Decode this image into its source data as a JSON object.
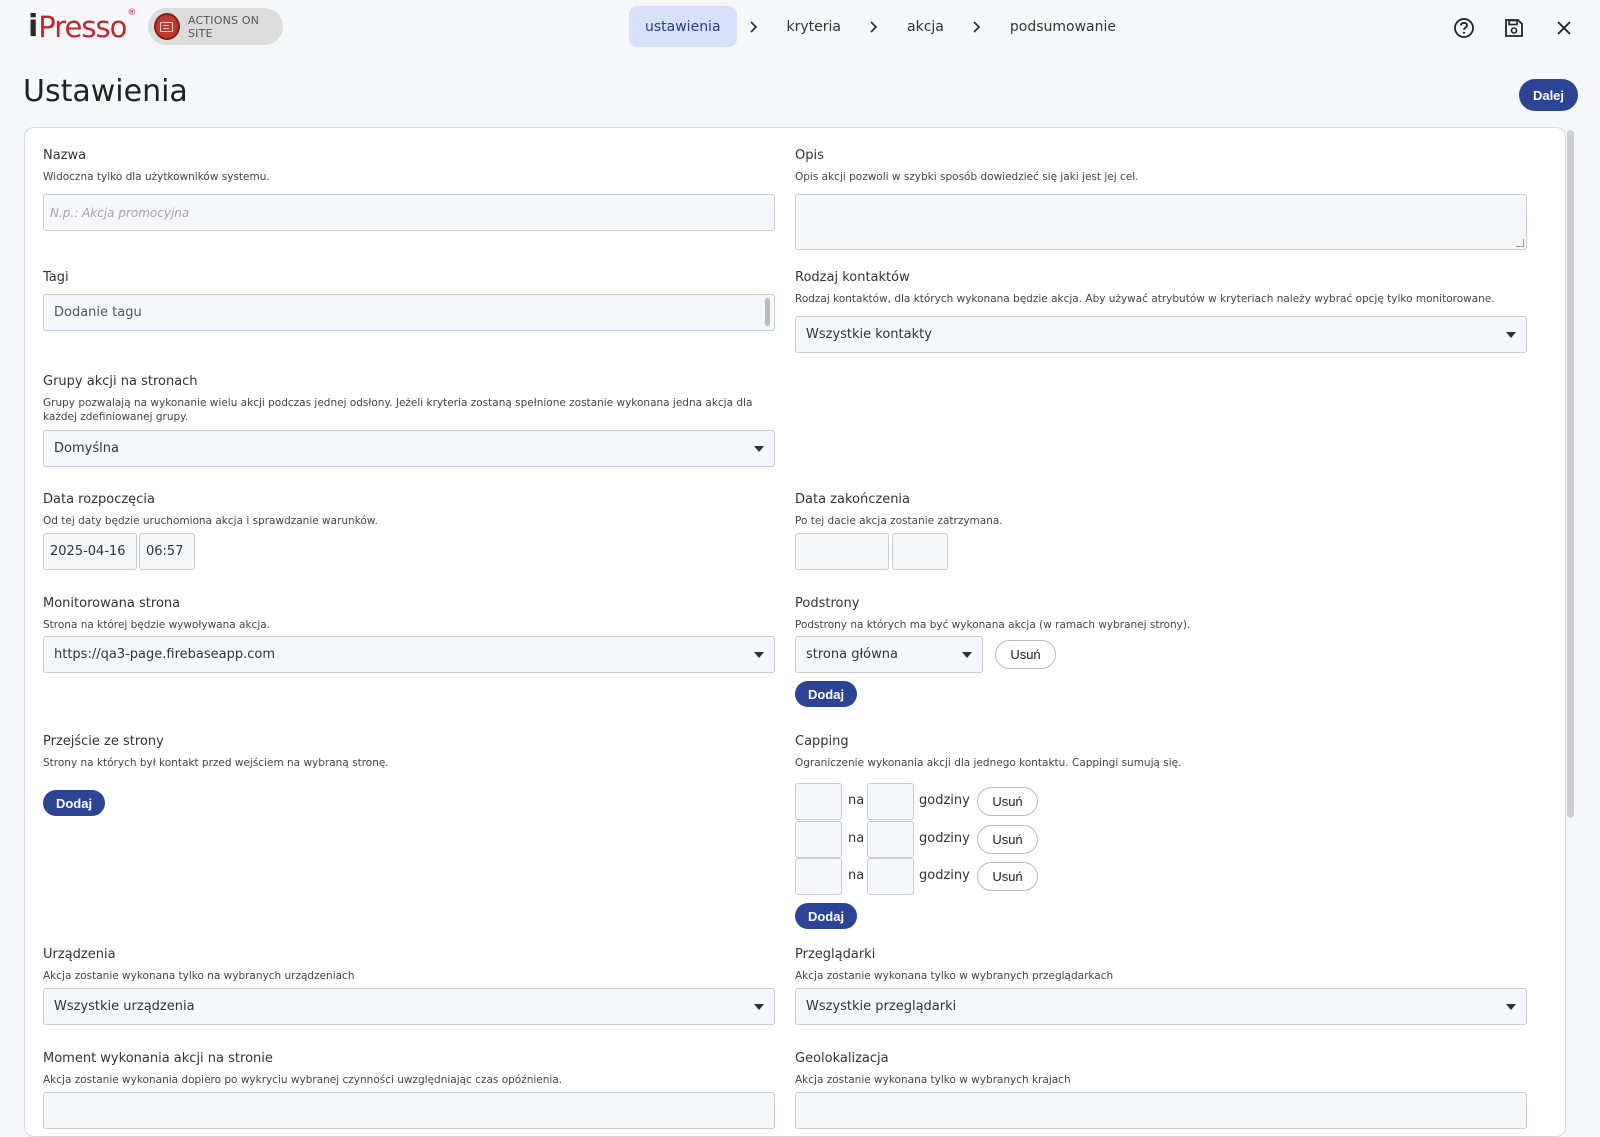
{
  "app": {
    "logo_i": "i",
    "logo_text": "Presso",
    "logo_reg": "®",
    "module_label": "ACTIONS ON SITE"
  },
  "steps": [
    {
      "label": "ustawienia",
      "active": true
    },
    {
      "label": "kryteria",
      "active": false
    },
    {
      "label": "akcja",
      "active": false
    },
    {
      "label": "podsumowanie",
      "active": false
    }
  ],
  "icons": {
    "step_separator": "chevron-right-icon",
    "help": "help-icon",
    "save": "save-icon",
    "close": "close-icon"
  },
  "header": {
    "title": "Ustawienia",
    "next_label": "Dalej"
  },
  "form": {
    "name": {
      "label": "Nazwa",
      "hint": "Widoczna tylko dla użytkowników systemu.",
      "placeholder": "N.p.: Akcja promocyjna",
      "value": ""
    },
    "description": {
      "label": "Opis",
      "hint": "Opis akcji pozwoli w szybki sposób dowiedzieć się jaki jest jej cel.",
      "value": ""
    },
    "tags": {
      "label": "Tagi",
      "value": "Dodanie tagu"
    },
    "contact_type": {
      "label": "Rodzaj kontaktów",
      "hint": "Rodzaj kontaktów, dla których wykonana będzie akcja. Aby używać atrybutów w kryteriach należy wybrać opcję tylko monitorowane.",
      "value": "Wszystkie kontakty"
    },
    "groups": {
      "label": "Grupy akcji na stronach",
      "hint": "Grupy pozwalają na wykonanie wielu akcji podczas jednej odsłony. Jeżeli kryteria zostaną spełnione zostanie wykonana jedna akcja dla każdej zdefiniowanej grupy.",
      "value": "Domyślna"
    },
    "start_date": {
      "label": "Data rozpoczęcia",
      "hint": "Od tej daty będzie uruchomiona akcja i sprawdzanie warunków.",
      "date": "2025-04-16",
      "time": "06:57"
    },
    "end_date": {
      "label": "Data zakończenia",
      "hint": "Po tej dacie akcja zostanie zatrzymana.",
      "date": "",
      "time": ""
    },
    "monitored_site": {
      "label": "Monitorowana strona",
      "hint": "Strona na której będzie wywoływana akcja.",
      "value": "https://qa3-page.firebaseapp.com"
    },
    "subpages": {
      "label": "Podstrony",
      "hint": "Podstrony na których ma być wykonana akcja (w ramach wybranej strony).",
      "value": "strona główna",
      "remove_label": "Usuń",
      "add_label": "Dodaj"
    },
    "referrer": {
      "label": "Przejście ze strony",
      "hint": "Strony na których był kontakt przed wejściem na wybraną stronę.",
      "add_label": "Dodaj"
    },
    "capping": {
      "label": "Capping",
      "hint": "Ograniczenie wykonania akcji dla jednego kontaktu. Cappingi sumują się.",
      "rows": [
        {
          "count": "",
          "per": "na",
          "hours": "",
          "unit": "godziny",
          "remove_label": "Usuń"
        },
        {
          "count": "",
          "per": "na",
          "hours": "",
          "unit": "godziny",
          "remove_label": "Usuń"
        },
        {
          "count": "",
          "per": "na",
          "hours": "",
          "unit": "godziny",
          "remove_label": "Usuń"
        }
      ],
      "add_label": "Dodaj"
    },
    "devices": {
      "label": "Urządzenia",
      "hint": "Akcja zostanie wykonana tylko na wybranych urządzeniach",
      "value": "Wszystkie urządzenia"
    },
    "browsers": {
      "label": "Przeglądarki",
      "hint": "Akcja zostanie wykonana tylko w wybranych przeglądarkach",
      "value": "Wszystkie przeglądarki"
    },
    "moment": {
      "label": "Moment wykonania akcji na stronie",
      "hint": "Akcja zostanie wykonania dopiero po wykryciu wybranej czynności uwzględniając czas opóźnienia."
    },
    "geo": {
      "label": "Geolokalizacja",
      "hint": "Akcja zostanie wykonana tylko w wybranych krajach"
    }
  },
  "colors": {
    "primary": "#2b4494",
    "brand_red": "#c4262e",
    "active_step_bg": "#d6e0f9"
  }
}
